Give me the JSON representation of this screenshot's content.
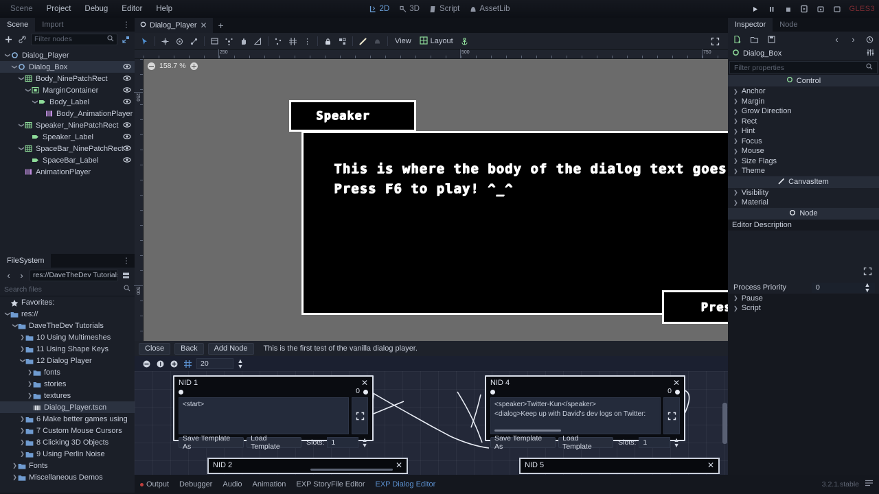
{
  "menu": {
    "items": [
      {
        "label": "Scene",
        "dim": true
      },
      {
        "label": "Project",
        "dim": false
      },
      {
        "label": "Debug",
        "dim": false
      },
      {
        "label": "Editor",
        "dim": false
      },
      {
        "label": "Help",
        "dim": false
      }
    ]
  },
  "center_tabs": [
    {
      "label": "2D",
      "icon": "2d-icon",
      "active": true
    },
    {
      "label": "3D",
      "icon": "3d-icon",
      "active": false
    },
    {
      "label": "Script",
      "icon": "script-icon",
      "active": false
    },
    {
      "label": "AssetLib",
      "icon": "assetlib-icon",
      "active": false
    }
  ],
  "playback": {
    "icons": [
      "play-icon",
      "pause-icon",
      "stop-icon",
      "play-scene-icon",
      "play-custom-scene-icon",
      "movie-icon"
    ],
    "renderer": "GLES3"
  },
  "scene_dock": {
    "tabs": [
      {
        "label": "Scene",
        "active": true
      },
      {
        "label": "Import",
        "active": false
      }
    ],
    "toolbar": {
      "add_icon": "plus-icon",
      "link_icon": "instance-child-scene-icon",
      "filter_placeholder": "Filter nodes",
      "search_icon": "search-icon",
      "collapse_icon": "collapse-all-icon"
    },
    "nodes": [
      {
        "label": "Dialog_Player",
        "depth": 0,
        "icon": "control-node-icon",
        "icon_color": "#8eb7e0",
        "arrow": "v",
        "selected": false,
        "eye": false
      },
      {
        "label": "Dialog_Box",
        "depth": 1,
        "icon": "control-node-icon",
        "icon_color": "#8eb7e0",
        "arrow": "v",
        "selected": true,
        "eye": true
      },
      {
        "label": "Body_NinePatchRect",
        "depth": 2,
        "icon": "ninepatchrect-icon",
        "icon_color": "#8fdc9a",
        "arrow": "v",
        "selected": false,
        "eye": true
      },
      {
        "label": "MarginContainer",
        "depth": 3,
        "icon": "margincontainer-icon",
        "icon_color": "#8fdc9a",
        "arrow": "v",
        "selected": false,
        "eye": true
      },
      {
        "label": "Body_Label",
        "depth": 4,
        "icon": "label-icon",
        "icon_color": "#8fdc9a",
        "arrow": "v",
        "selected": false,
        "eye": true
      },
      {
        "label": "Body_AnimationPlayer",
        "depth": 5,
        "icon": "animationplayer-icon",
        "icon_color": "#c08ee0",
        "arrow": "",
        "selected": false,
        "eye": false
      },
      {
        "label": "Speaker_NinePatchRect",
        "depth": 2,
        "icon": "ninepatchrect-icon",
        "icon_color": "#8fdc9a",
        "arrow": "v",
        "selected": false,
        "eye": true
      },
      {
        "label": "Speaker_Label",
        "depth": 3,
        "icon": "label-icon",
        "icon_color": "#8fdc9a",
        "arrow": "",
        "selected": false,
        "eye": true
      },
      {
        "label": "SpaceBar_NinePatchRect",
        "depth": 2,
        "icon": "ninepatchrect-icon",
        "icon_color": "#8fdc9a",
        "arrow": "v",
        "selected": false,
        "eye": true
      },
      {
        "label": "SpaceBar_Label",
        "depth": 3,
        "icon": "label-icon",
        "icon_color": "#8fdc9a",
        "arrow": "",
        "selected": false,
        "eye": true
      },
      {
        "label": "AnimationPlayer",
        "depth": 2,
        "icon": "animationplayer-icon",
        "icon_color": "#c08ee0",
        "arrow": "",
        "selected": false,
        "eye": false
      }
    ]
  },
  "filesystem": {
    "tab": "FileSystem",
    "path": "res://DaveTheDev Tutorials/",
    "search_placeholder": "Search files",
    "nav_back": "‹",
    "nav_fwd": "›",
    "items": [
      {
        "label": "Favorites:",
        "depth": 0,
        "type": "star",
        "arrow": "",
        "selected": false
      },
      {
        "label": "res://",
        "depth": 0,
        "type": "folder",
        "arrow": "v",
        "selected": false
      },
      {
        "label": "DaveTheDev Tutorials",
        "depth": 1,
        "type": "folder",
        "arrow": "v",
        "selected": false
      },
      {
        "label": "10 Using Multimeshes",
        "depth": 2,
        "type": "folder",
        "arrow": ">",
        "selected": false
      },
      {
        "label": "11 Using Shape Keys",
        "depth": 2,
        "type": "folder",
        "arrow": ">",
        "selected": false
      },
      {
        "label": "12 Dialog Player",
        "depth": 2,
        "type": "folder",
        "arrow": "v",
        "selected": false
      },
      {
        "label": "fonts",
        "depth": 3,
        "type": "folder",
        "arrow": ">",
        "selected": false
      },
      {
        "label": "stories",
        "depth": 3,
        "type": "folder",
        "arrow": ">",
        "selected": false
      },
      {
        "label": "textures",
        "depth": 3,
        "type": "folder",
        "arrow": ">",
        "selected": false
      },
      {
        "label": "Dialog_Player.tscn",
        "depth": 3,
        "type": "scene",
        "arrow": "",
        "selected": true
      },
      {
        "label": "6 Make better games using",
        "depth": 2,
        "type": "folder",
        "arrow": ">",
        "selected": false
      },
      {
        "label": "7 Custom Mouse Cursors",
        "depth": 2,
        "type": "folder",
        "arrow": ">",
        "selected": false
      },
      {
        "label": "8 Clicking 3D Objects",
        "depth": 2,
        "type": "folder",
        "arrow": ">",
        "selected": false
      },
      {
        "label": "9 Using Perlin Noise",
        "depth": 2,
        "type": "folder",
        "arrow": ">",
        "selected": false
      },
      {
        "label": "Fonts",
        "depth": 1,
        "type": "folder",
        "arrow": ">",
        "selected": false
      },
      {
        "label": "Miscellaneous Demos",
        "depth": 1,
        "type": "folder",
        "arrow": ">",
        "selected": false
      }
    ]
  },
  "scene_tabs": [
    {
      "label": "Dialog_Player",
      "close": "✕",
      "active": true
    }
  ],
  "scene_tab_add": "+",
  "viewport": {
    "toolbar": {
      "icons": [
        "select-mode-icon",
        "move-mode-icon",
        "rotate-mode-icon",
        "scale-mode-icon",
        "list-mode-icon",
        "pan-pivot-icon",
        "pan-mode-icon",
        "ruler-mode-icon",
        "smart-snap-icon",
        "grid-snap-icon",
        "snap-options-icon",
        "lock-icon",
        "group-icon",
        "skeleton-icon",
        "bone-icon"
      ],
      "view_label": "View",
      "layout_label": "Layout",
      "layout_icon": "layout-grid-icon",
      "anchor_icon": "anchor-icon",
      "expand_icon": "fullscreen-icon"
    },
    "zoom_level": "158.7 %",
    "zoom_out_icon": "zoom-out-icon",
    "zoom_in_icon": "zoom-in-icon",
    "ruler_h_labels": [
      "250",
      "500",
      "750"
    ],
    "ruler_v_labels": [
      "250",
      "500"
    ],
    "dialog": {
      "speaker_text": "Speaker",
      "body_line1": "This is where the body of the dialog text goes.",
      "body_line2": "Press F6 to play! ^_^",
      "spacebar_text": "Press Spacebar"
    }
  },
  "dialog_editor": {
    "toolbar": {
      "close_label": "Close",
      "back_label": "Back",
      "add_node_label": "Add Node",
      "status": "This is the first test of the vanilla dialog player."
    },
    "graph_toolbar": {
      "zoom_out_icon": "zoom-out-icon",
      "zoom_reset_icon": "zoom-reset-icon",
      "zoom_in_icon": "zoom-in-icon",
      "snap_icon": "grid-snap-icon",
      "snap_value": "20"
    },
    "nodes": [
      {
        "title": "NID 1",
        "close": "✕",
        "out_slot": "0",
        "text": "<start>",
        "text2": "",
        "save_label": "Save Template As",
        "load_label": "Load Template",
        "slots_label": "Slots:",
        "slots_value": "1",
        "expand_icon": "expand-text-icon",
        "collapsed": false,
        "has_scrollbar": false
      },
      {
        "title": "NID 4",
        "close": "✕",
        "out_slot": "0",
        "text": "<speaker>Twitter-Kun</speaker>",
        "text2": "<dialog>Keep up with David's dev logs on Twitter:",
        "save_label": "Save Template As",
        "load_label": "Load Template",
        "slots_label": "Slots:",
        "slots_value": "1",
        "expand_icon": "expand-text-icon",
        "collapsed": false,
        "has_scrollbar": true
      },
      {
        "title": "NID 2",
        "close": "✕",
        "collapsed": true
      },
      {
        "title": "NID 5",
        "close": "✕",
        "collapsed": true
      }
    ]
  },
  "inspector": {
    "tabs": [
      {
        "label": "Inspector",
        "active": true
      },
      {
        "label": "Node",
        "active": false
      }
    ],
    "toolbar_icons": [
      "new-resource-icon",
      "load-resource-icon",
      "save-resource-icon",
      "history-prev-icon",
      "history-next-icon",
      "history-icon"
    ],
    "object_name": "Dialog_Box",
    "object_icon": "control-node-icon",
    "object_tools_icon": "object-menu-icon",
    "filter_placeholder": "Filter properties",
    "search_icon": "search-icon",
    "sections": [
      {
        "type": "category",
        "label": "Control",
        "icon": "control-node-icon"
      },
      {
        "type": "prop",
        "label": "Anchor"
      },
      {
        "type": "prop",
        "label": "Margin"
      },
      {
        "type": "prop",
        "label": "Grow Direction"
      },
      {
        "type": "prop",
        "label": "Rect"
      },
      {
        "type": "prop",
        "label": "Hint"
      },
      {
        "type": "prop",
        "label": "Focus"
      },
      {
        "type": "prop",
        "label": "Mouse"
      },
      {
        "type": "prop",
        "label": "Size Flags"
      },
      {
        "type": "prop",
        "label": "Theme"
      },
      {
        "type": "category",
        "label": "CanvasItem",
        "icon": "canvasitem-icon"
      },
      {
        "type": "prop",
        "label": "Visibility"
      },
      {
        "type": "prop",
        "label": "Material"
      },
      {
        "type": "category",
        "label": "Node",
        "icon": "node-icon"
      }
    ],
    "editor_description_label": "Editor Description",
    "resize_icon": "resize-handle-icon",
    "process_priority_label": "Process Priority",
    "process_priority_value": "0",
    "footer_props": [
      {
        "label": "Pause"
      },
      {
        "label": "Script"
      }
    ]
  },
  "statusbar": {
    "items": [
      {
        "label": "Output",
        "active": false,
        "dot": true
      },
      {
        "label": "Debugger",
        "active": false,
        "dot": false
      },
      {
        "label": "Audio",
        "active": false,
        "dot": false
      },
      {
        "label": "Animation",
        "active": false,
        "dot": false
      },
      {
        "label": "EXP StoryFile Editor",
        "active": false,
        "dot": false
      },
      {
        "label": "EXP Dialog Editor",
        "active": true,
        "dot": false
      }
    ],
    "version": "3.2.1.stable",
    "layout_icon": "bottom-panel-layout-icon"
  },
  "colors": {
    "accent": "#5b90cf",
    "panel": "#1b1f28",
    "dark": "#15181f",
    "green_node": "#8fdc9a",
    "purple_node": "#c08ee0",
    "red": "#c0403e"
  }
}
